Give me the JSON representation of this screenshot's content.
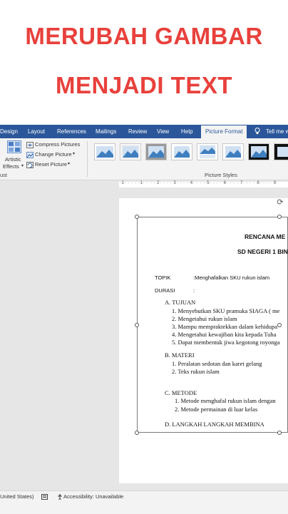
{
  "overlay_title": {
    "line1": "MERUBAH GAMBAR",
    "line2": "MENJADI TEXT",
    "color": "#e8413c"
  },
  "ribbon_tabs": [
    {
      "label": "Design"
    },
    {
      "label": "Layout"
    },
    {
      "label": "References"
    },
    {
      "label": "Mailings"
    },
    {
      "label": "Review"
    },
    {
      "label": "View"
    },
    {
      "label": "Help"
    },
    {
      "label": "Picture Format",
      "active": true
    }
  ],
  "tell_me": "Tell me w",
  "ribbon": {
    "artistic_effects_line1": "Artistic",
    "artistic_effects_line2": "Effects",
    "compress_pictures": "Compress Pictures",
    "change_picture": "Change Picture",
    "reset_picture": "Reset Picture",
    "adjust_group": "ust",
    "picture_styles_group": "Picture Styles"
  },
  "ruler_text": "·1· · · · ·1· · · · 2· · · · 3· · · · 4· · · · 5· · · · 6· · · · 7· · · · 8· · · · 9",
  "document": {
    "heading1": "RENCANA ME",
    "heading2": "SD NEGERI 1 BIN",
    "topik_label": "TOPIK",
    "topik_value": ":Menghafalkan SKU rukun islam",
    "durasi_label": "DURASI",
    "durasi_value": ":",
    "sections": [
      {
        "title": "A.   TUJUAN",
        "items": [
          "1.  Menyebutkan SKU pramuka SIAGA ( me",
          "2.  Mengetahui rukun islam",
          "3.  Mampu mempraktekkan dalam kehidupa",
          "4.  Mengetahui kewajiban kita kepada Tuha",
          "5.  Dapat membentuk jiwa kegotong royonga"
        ]
      },
      {
        "title": "B.   MATERI",
        "items": [
          "1.   Peralatan sedotan dan karet gelang",
          "2.   Teks rukun islam"
        ]
      },
      {
        "title": "C.   METODE",
        "items": [
          "1.   Metode menghafal rukun islam dengan",
          "2.   Metode permainan di luar kelas"
        ]
      },
      {
        "title": "D.   LANGKAH LANGKAH  MEMBINA",
        "items": []
      }
    ]
  },
  "status": {
    "language": "United States)",
    "accessibility": "Accessibility: Unavailable"
  },
  "colors": {
    "ribbon_blue": "#2b579a",
    "ribbon_bg": "#f3f3f3",
    "canvas_bg": "#e6e6e6"
  }
}
